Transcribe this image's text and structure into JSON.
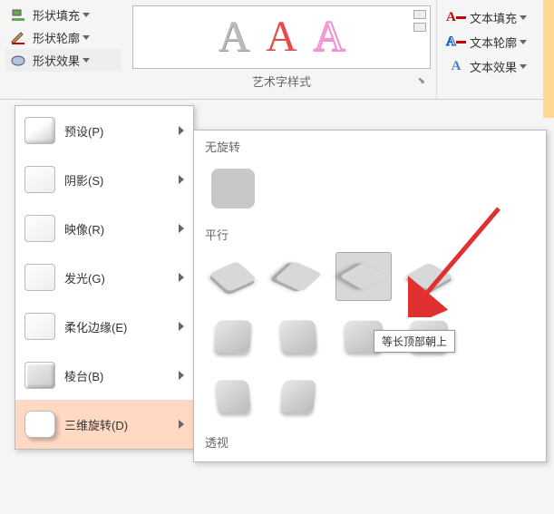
{
  "ribbon": {
    "shape_fill": "形状填充",
    "shape_outline": "形状轮廓",
    "shape_effects": "形状效果",
    "text_fill": "文本填充",
    "text_outline": "文本轮廓",
    "text_effects": "文本效果",
    "wordart_section": "艺术字样式"
  },
  "effects_menu": {
    "preset": "预设(P)",
    "shadow": "阴影(S)",
    "reflection": "映像(R)",
    "glow": "发光(G)",
    "soft_edges": "柔化边缘(E)",
    "bevel": "棱台(B)",
    "rotation3d": "三维旋转(D)"
  },
  "rotation_gallery": {
    "no_rotation": "无旋转",
    "parallel": "平行",
    "perspective": "透视",
    "tooltip": "等长顶部朝上"
  }
}
